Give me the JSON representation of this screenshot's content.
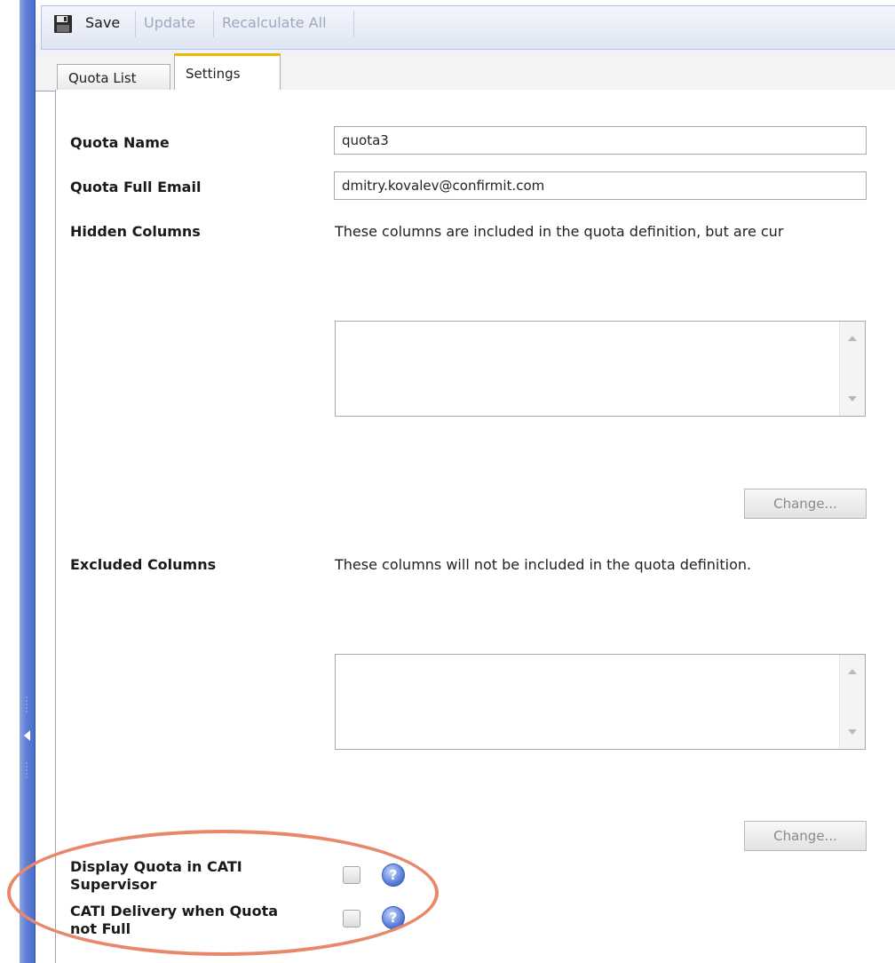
{
  "toolbar": {
    "save_label": "Save",
    "update_label": "Update",
    "recalculate_label": "Recalculate All"
  },
  "tabs": [
    {
      "label": "Quota List",
      "active": false
    },
    {
      "label": "Settings",
      "active": true
    }
  ],
  "settings": {
    "quota_name_label": "Quota Name",
    "quota_name_value": "quota3",
    "quota_full_email_label": "Quota Full Email",
    "quota_full_email_value": "dmitry.kovalev@confirmit.com",
    "hidden_columns_label": "Hidden Columns",
    "hidden_columns_desc": "These columns are included in the quota definition, but are cur",
    "hidden_change_label": "Change...",
    "excluded_columns_label": "Excluded Columns",
    "excluded_columns_desc": "These columns will not be included in the quota definition.",
    "excluded_change_label": "Change...",
    "display_cati_label_line1": "Display Quota in CATI",
    "display_cati_label_line2": "Supervisor",
    "display_cati_checked": false,
    "cati_delivery_label_line1": "CATI Delivery when Quota",
    "cati_delivery_label_line2": "not Full",
    "cati_delivery_checked": false,
    "help_glyph": "?"
  },
  "colors": {
    "splitter": "#5f7fd6",
    "active_tab_accent": "#f0b400",
    "highlight_ellipse": "#e8876a",
    "disabled_text": "#9ea8bf"
  },
  "icons": {
    "save": "floppy-disk-icon",
    "help": "help-icon"
  }
}
